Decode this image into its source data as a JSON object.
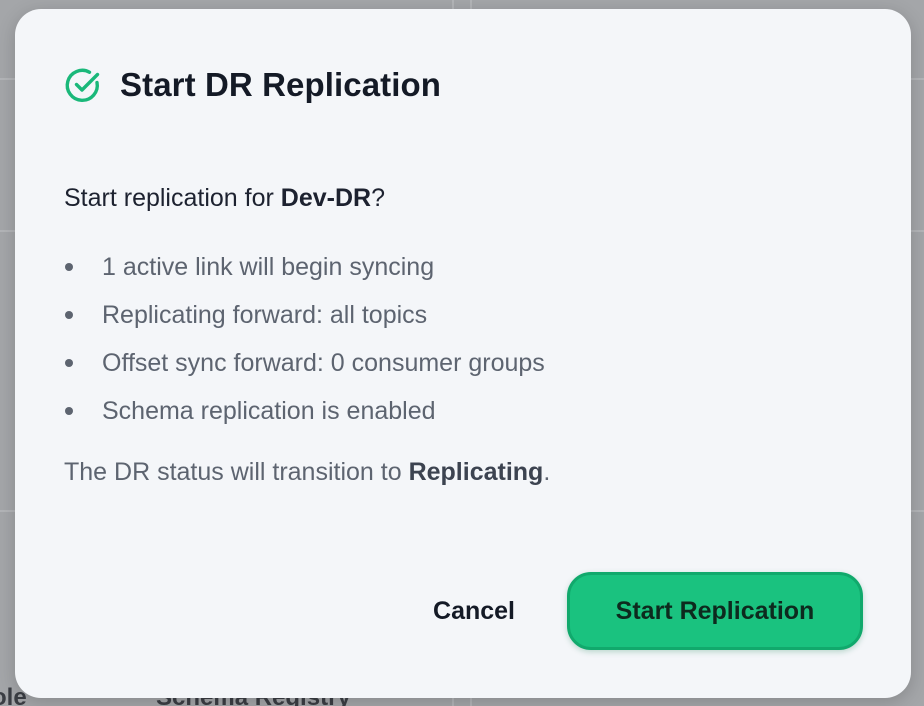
{
  "background": {
    "text_left": "ole",
    "text_right": "Schema Registry"
  },
  "dialog": {
    "icon": "check-circle-icon",
    "title": "Start DR Replication",
    "question_prefix": "Start replication for ",
    "question_target": "Dev-DR",
    "question_suffix": "?",
    "bullets": [
      "1 active link will begin syncing",
      "Replicating forward: all topics",
      "Offset sync forward: 0 consumer groups",
      "Schema replication is enabled"
    ],
    "status_prefix": "The DR status will transition to ",
    "status_value": "Replicating",
    "status_suffix": ".",
    "cancel_label": "Cancel",
    "confirm_label": "Start Replication"
  },
  "colors": {
    "accent": "#1ac27f",
    "accent_border": "#11a96c",
    "icon": "#1ab87a"
  }
}
